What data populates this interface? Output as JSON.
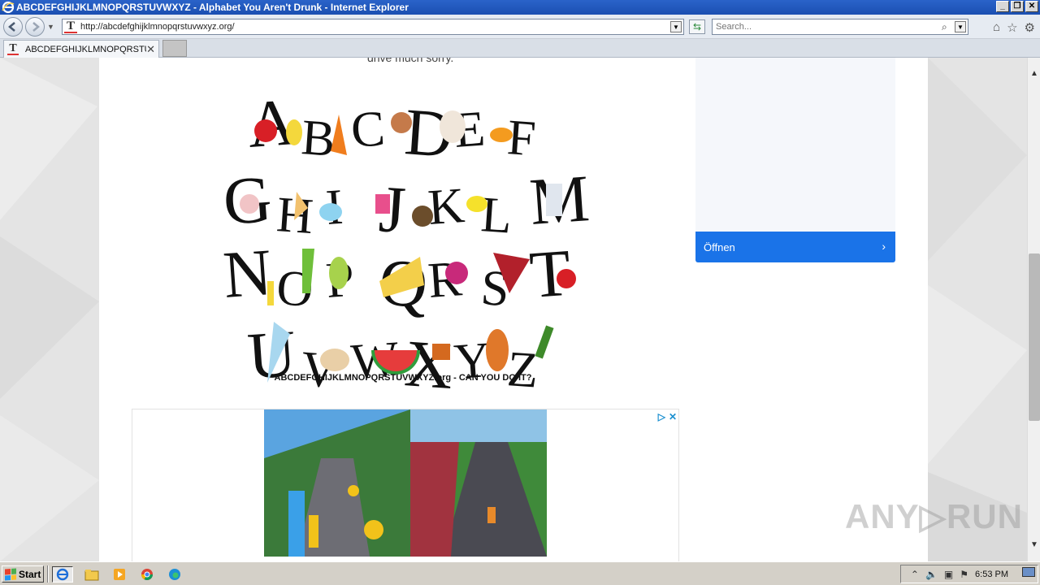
{
  "window": {
    "title": "ABCDEFGHIJKLMNOPQRSTUVWXYZ - Alphabet You Aren't Drunk - Internet Explorer",
    "min_label": "_",
    "max_label": "❐",
    "close_label": "✕"
  },
  "navbar": {
    "url": "http://abcdefghijklmnopqrstuvwxyz.org/",
    "search_placeholder": "Search..."
  },
  "tabs": [
    {
      "label": "ABCDEFGHIJKLMNOPQRSTU...",
      "close": "✕"
    }
  ],
  "page": {
    "cut_text": "drive much sorry.",
    "alphabet_rows": [
      [
        "A",
        "B",
        "C",
        "D",
        "E",
        "F"
      ],
      [
        "G",
        "H",
        "I",
        "J",
        "K",
        "L",
        "M"
      ],
      [
        "N",
        "O",
        "P",
        "Q",
        "R",
        "S",
        "T"
      ],
      [
        "U",
        "V",
        "W",
        "X",
        "Y",
        "Z"
      ]
    ],
    "alphabet_caption": "ABCDEFGHIJKLMNOPQRSTUVWXYZ.org - CAN YOU DO IT?",
    "side_ad_button": "Öffnen",
    "side_ad_chevron": "›",
    "watermark": "ANY▷RUN"
  },
  "taskbar": {
    "start_label": "Start",
    "clock": "6:53 PM"
  },
  "colors": {
    "accent": "#1a73e8",
    "titlebar": "#2a63c9"
  }
}
